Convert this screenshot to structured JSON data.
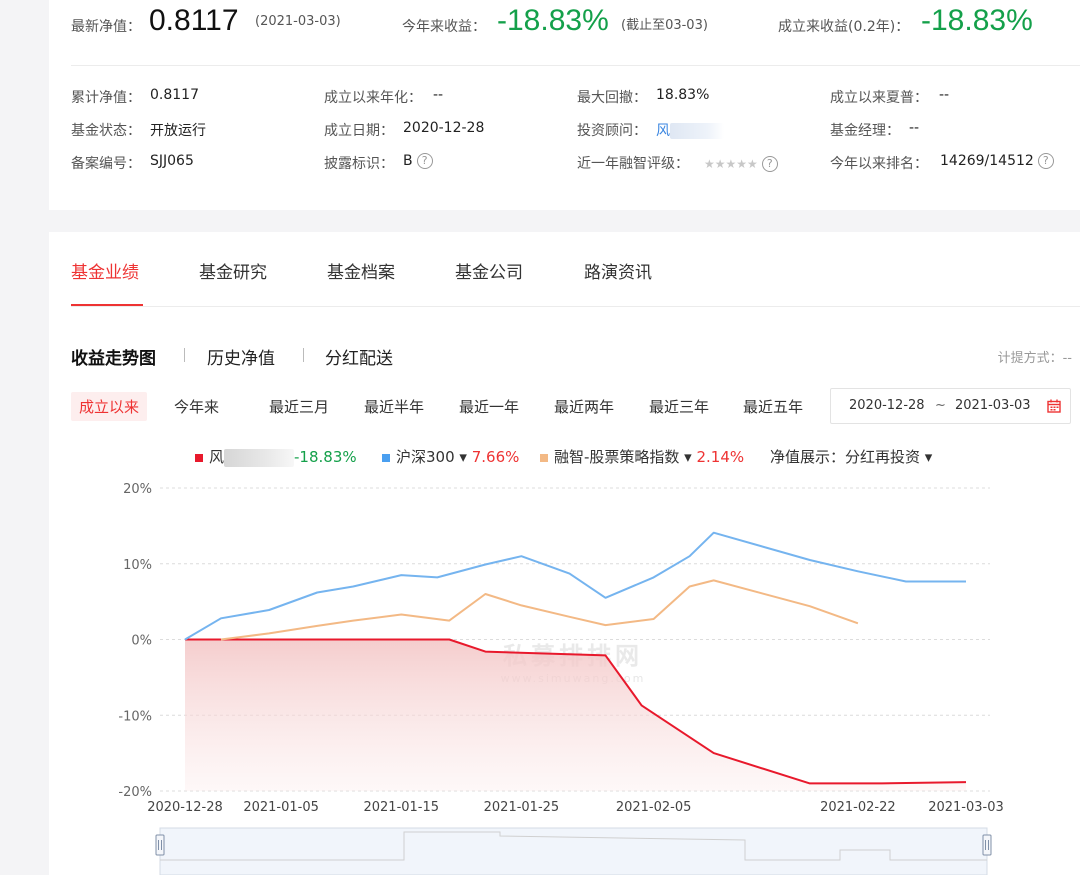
{
  "summary": {
    "nav_label": "最新净值：",
    "nav_value": "0.8117",
    "nav_date": "(2021-03-03)",
    "ytd_label": "今年来收益：",
    "ytd_value": "-18.83%",
    "ytd_note": "(截止至03-03)",
    "since_label": "成立来收益(0.2年)：",
    "since_value": "-18.83%"
  },
  "info": {
    "cum_nav_label": "累计净值：",
    "cum_nav_value": "0.8117",
    "ann_label": "成立以来年化：",
    "ann_value": "--",
    "maxdd_label": "最大回撤：",
    "maxdd_value": "18.83%",
    "sharpe_label": "成立以来夏普：",
    "sharpe_value": "--",
    "status_label": "基金状态：",
    "status_value": "开放运行",
    "found_label": "成立日期：",
    "found_value": "2020-12-28",
    "advisor_label": "投资顾问：",
    "advisor_value": "风",
    "manager_label": "基金经理：",
    "manager_value": "--",
    "reg_label": "备案编号：",
    "reg_value": "SJJ065",
    "disclose_label": "披露标识：",
    "disclose_value": "B",
    "rating_label": "近一年融智评级：",
    "rating_stars": "★★★★★",
    "rank_label": "今年以来排名：",
    "rank_value": "14269/14512",
    "help_glyph": "?"
  },
  "tabs": [
    "基金业绩",
    "基金研究",
    "基金档案",
    "基金公司",
    "路演资讯"
  ],
  "subtabs": [
    "收益走势图",
    "历史净值",
    "分红配送"
  ],
  "accrual_label": "计提方式：--",
  "ranges": [
    "成立以来",
    "今年来",
    "最近三月",
    "最近半年",
    "最近一年",
    "最近两年",
    "最近三年",
    "最近五年"
  ],
  "date_range": {
    "start": "2020-12-28",
    "sep": "~",
    "end": "2021-03-03"
  },
  "legend": {
    "fund_name": "风",
    "fund_return": "-18.83%",
    "hs300_name": "沪深300 ▾",
    "hs300_return": "7.66%",
    "index_name": "融智-股票策略指数 ▾",
    "index_return": "2.14%",
    "nav_display_label": "净值展示：",
    "nav_display_value": "分红再投资 ▾"
  },
  "watermark": {
    "main": "私募排排网",
    "sub": "www.simuwang.com"
  },
  "colors": {
    "fund": "#e8192c",
    "hs300": "#75b4ef",
    "index": "#f3b985",
    "green": "#14a04a",
    "red": "#e33333"
  },
  "chart_data": {
    "type": "line",
    "ylim": [
      -20,
      20
    ],
    "yticks": [
      "20%",
      "10%",
      "0%",
      "-10%",
      "-20%"
    ],
    "xticks": [
      "2020-12-28",
      "2021-01-05",
      "2021-01-15",
      "2021-01-25",
      "2021-02-05",
      "2021-02-22",
      "2021-03-03"
    ],
    "x_range": [
      "2020-12-28",
      "2021-03-03"
    ],
    "series": [
      {
        "name": "风",
        "color": "#e8192c",
        "area": true,
        "x": [
          "2020-12-28",
          "2021-01-19",
          "2021-01-22",
          "2021-02-01",
          "2021-02-04",
          "2021-02-10",
          "2021-02-18",
          "2021-02-24",
          "2021-03-03"
        ],
        "y": [
          0,
          0,
          -1.6,
          -2.1,
          -8.7,
          -15,
          -19,
          -19,
          -18.83
        ]
      },
      {
        "name": "沪深300",
        "color": "#75b4ef",
        "area": false,
        "x": [
          "2020-12-28",
          "2020-12-31",
          "2021-01-04",
          "2021-01-08",
          "2021-01-11",
          "2021-01-15",
          "2021-01-18",
          "2021-01-22",
          "2021-01-25",
          "2021-01-29",
          "2021-02-01",
          "2021-02-05",
          "2021-02-08",
          "2021-02-10",
          "2021-02-18",
          "2021-02-22",
          "2021-02-26",
          "2021-03-03"
        ],
        "y": [
          0,
          2.8,
          3.9,
          6.2,
          7,
          8.5,
          8.2,
          9.9,
          11,
          8.7,
          5.5,
          8.2,
          11,
          14.1,
          10.5,
          9,
          7.66,
          7.66
        ]
      },
      {
        "name": "融智-股票策略指数",
        "color": "#f3b985",
        "area": false,
        "x": [
          "2020-12-31",
          "2021-01-04",
          "2021-01-08",
          "2021-01-11",
          "2021-01-15",
          "2021-01-19",
          "2021-01-22",
          "2021-01-25",
          "2021-01-29",
          "2021-02-01",
          "2021-02-05",
          "2021-02-08",
          "2021-02-10",
          "2021-02-18",
          "2021-02-22"
        ],
        "y": [
          0,
          0.8,
          1.8,
          2.5,
          3.3,
          2.5,
          6,
          4.5,
          3,
          1.9,
          2.7,
          7,
          7.8,
          4.4,
          2.14
        ]
      }
    ]
  }
}
